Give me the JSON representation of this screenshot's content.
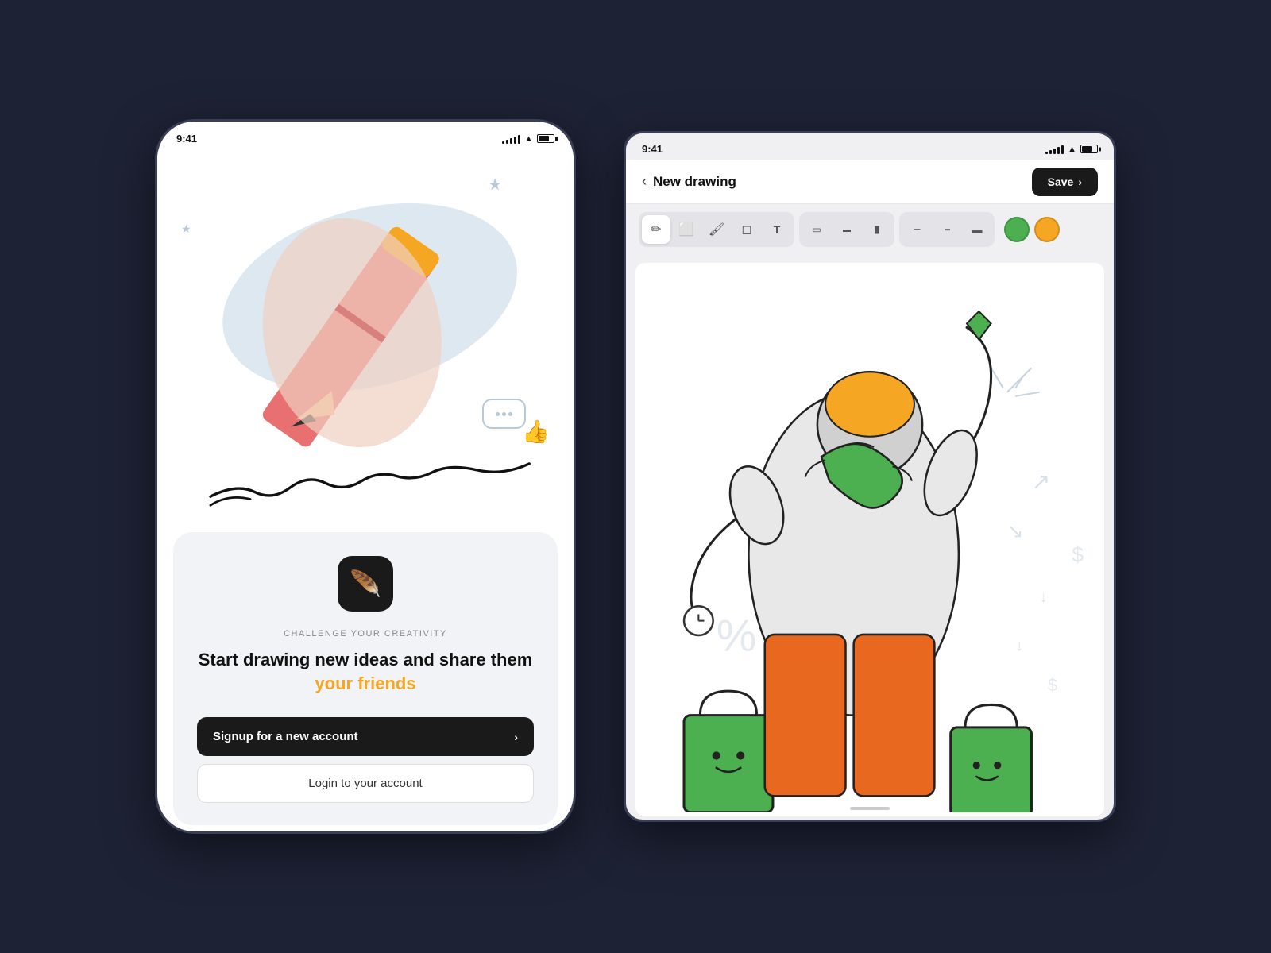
{
  "left_device": {
    "status": {
      "time": "9:41",
      "signal_bars": [
        3,
        5,
        7,
        9,
        11
      ],
      "battery_level": "70%"
    },
    "tagline_small": "CHALLENGE YOUR CREATIVITY",
    "tagline_main_part1": "Start drawing new ideas and share them ",
    "tagline_highlight": "your friends",
    "btn_signup_label": "Signup for a new account",
    "btn_login_label": "Login to your account"
  },
  "right_device": {
    "status": {
      "time": "9:41",
      "battery_level": "70%"
    },
    "header": {
      "back_label": "‹",
      "title": "New drawing",
      "save_label": "Save",
      "save_chevron": "›"
    },
    "toolbar": {
      "tools": [
        "✏️",
        "🖼",
        "🖌",
        "✒",
        "T"
      ],
      "stroke_sizes": [
        "thin",
        "medium",
        "thick"
      ],
      "line_sizes": [
        "—",
        "──",
        "━"
      ],
      "colors": [
        "#4caf50",
        "#f5a623"
      ]
    },
    "canvas": {
      "description": "Shopping celebration illustration"
    }
  },
  "colors": {
    "background": "#1e2235",
    "device_border": "#3a3f55",
    "accent_orange": "#f5a623",
    "accent_green": "#4caf50",
    "text_dark": "#111111",
    "btn_dark": "#1a1a1a"
  }
}
